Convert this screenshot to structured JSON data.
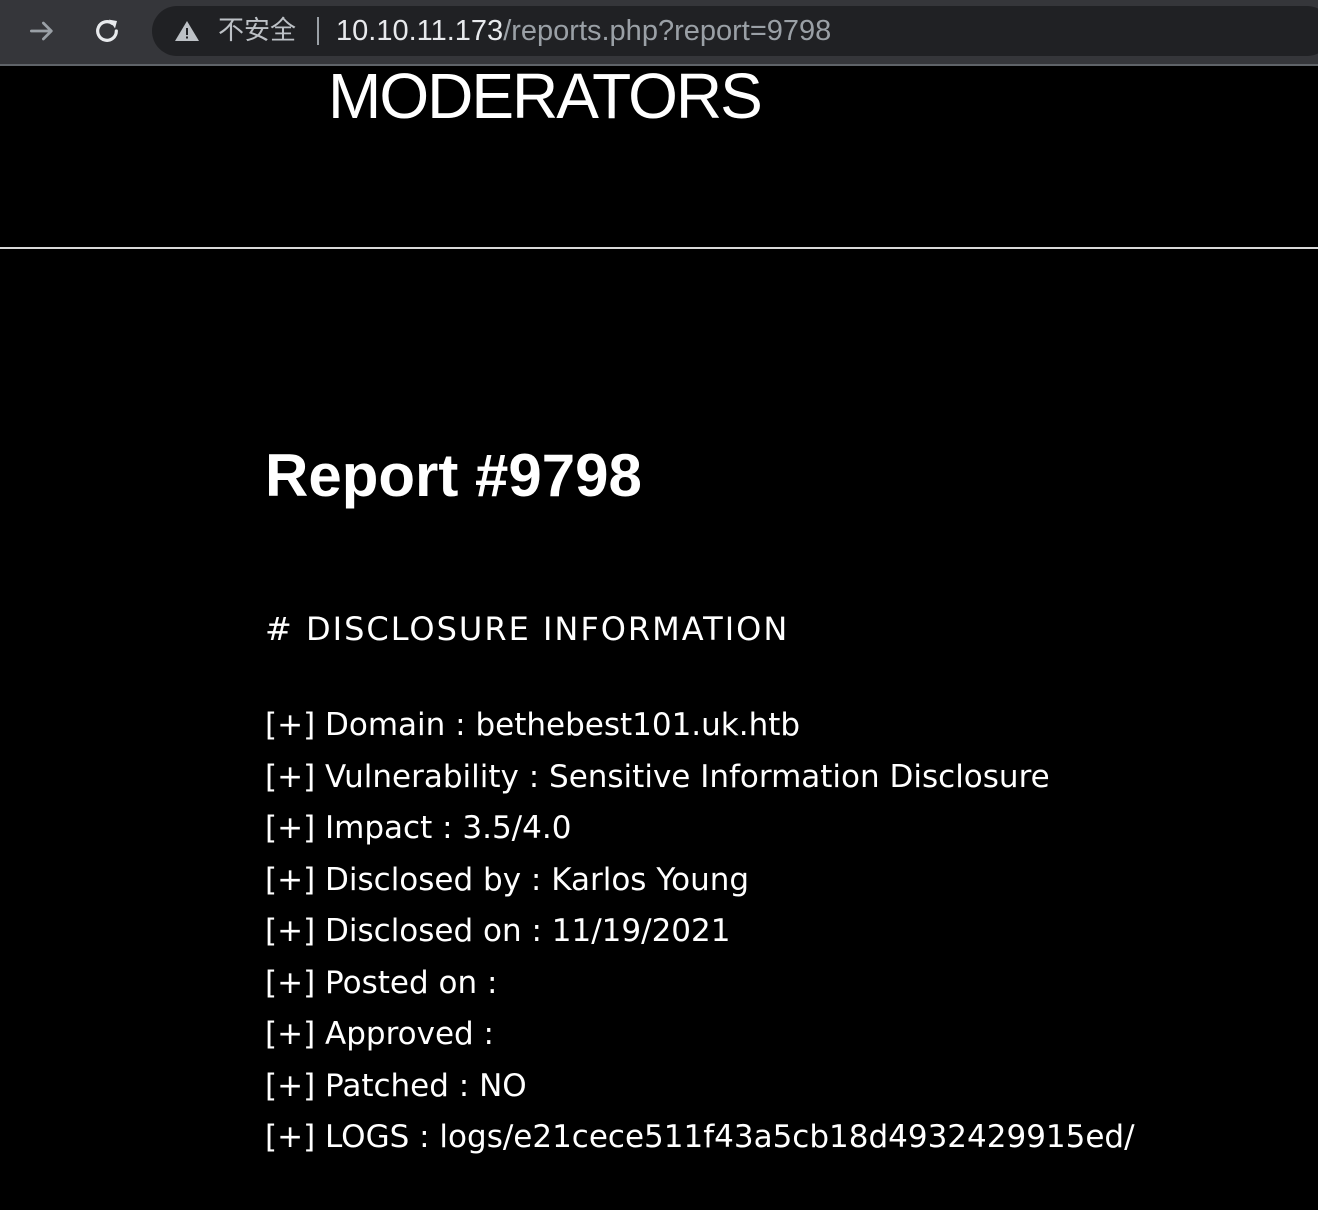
{
  "browser": {
    "security_label": "不安全",
    "url_host": "10.10.11.173",
    "url_path": "/reports.php?report=9798",
    "icons": {
      "forward": "arrow-right-icon",
      "reload": "reload-icon",
      "security": "warning-triangle-icon"
    }
  },
  "page": {
    "site_title": "MODERATORS",
    "report_title": "Report #9798",
    "section_heading": "# DISCLOSURE INFORMATION",
    "items": [
      {
        "text": "[+] Domain : bethebest101.uk.htb"
      },
      {
        "text": "[+] Vulnerability : Sensitive Information Disclosure"
      },
      {
        "text": "[+] Impact : 3.5/4.0"
      },
      {
        "text": "[+] Disclosed by : Karlos Young"
      },
      {
        "text": "[+] Disclosed on : 11/19/2021"
      },
      {
        "text": "[+] Posted on :"
      },
      {
        "text": "[+] Approved :"
      },
      {
        "text": "[+] Patched : NO"
      },
      {
        "text": "[+] LOGS : logs/e21cece511f43a5cb18d4932429915ed/"
      }
    ]
  },
  "colors": {
    "page_background": "#000000",
    "text": "#ffffff",
    "toolbar": "#35363a",
    "omnibox": "#202124",
    "url_host": "#e8eaed",
    "url_path": "#9aa0a6"
  }
}
